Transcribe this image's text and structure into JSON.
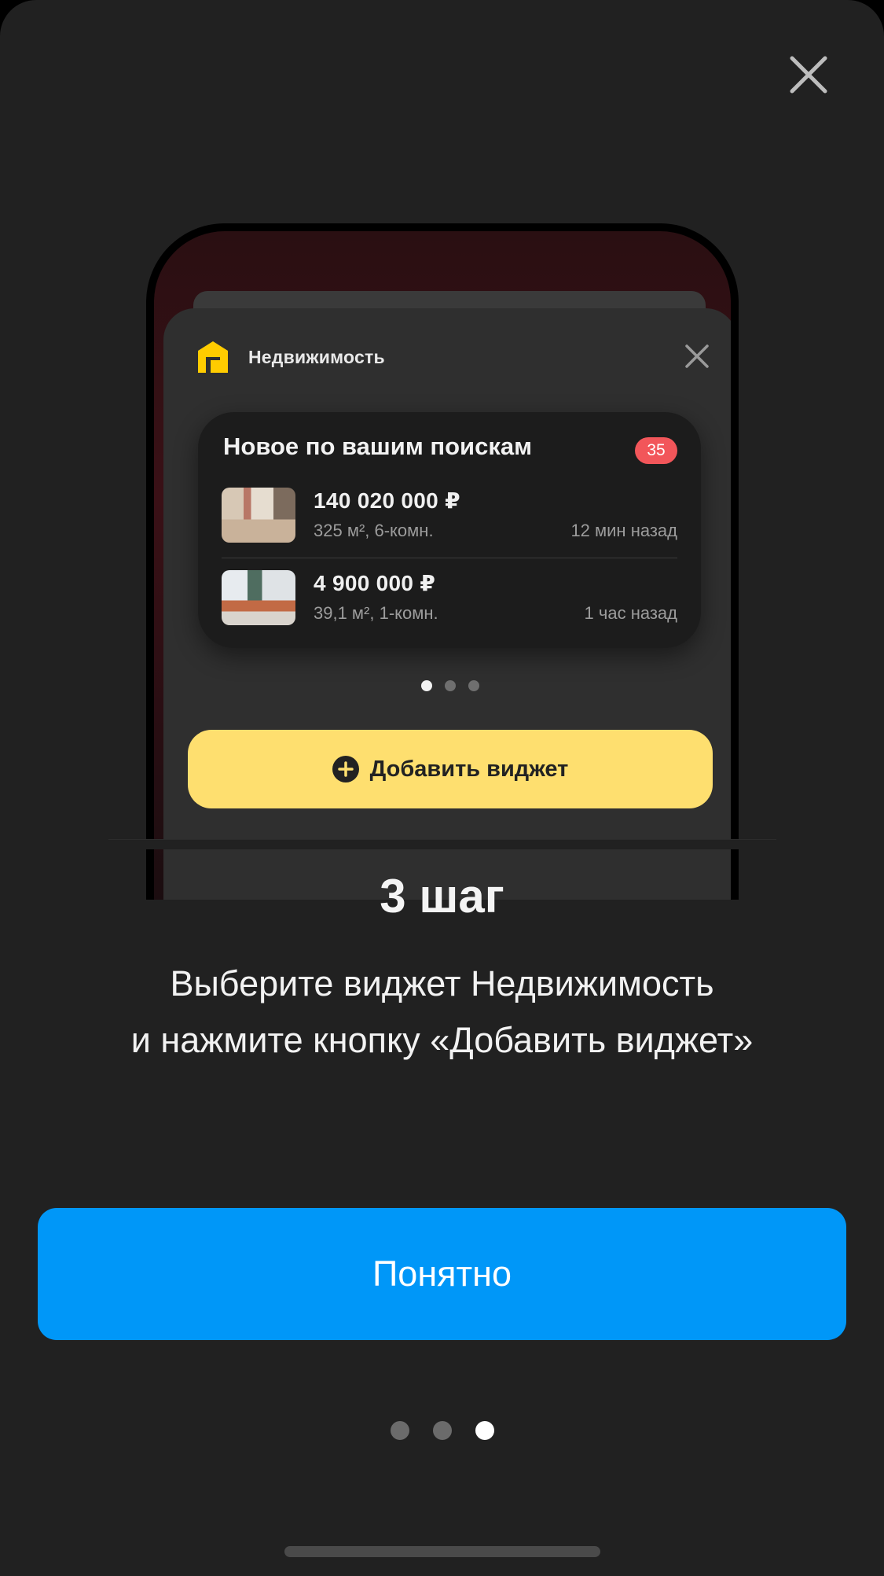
{
  "colors": {
    "sheet_bg": "#212121",
    "primary_button": "#0097f8",
    "widget_button": "#fedf6f",
    "badge": "#f2565a",
    "logo": "#ffcc00"
  },
  "preview": {
    "app_name": "Недвижимость",
    "app_icon": "house-logo-icon",
    "widget": {
      "title": "Новое по вашим поискам",
      "badge_count": "35",
      "listings": [
        {
          "price": "140 020 000 ₽",
          "details": "325 м², 6-комн.",
          "time": "12 мин назад"
        },
        {
          "price": "4 900 000 ₽",
          "details": "39,1 м², 1-комн.",
          "time": "1 час назад"
        }
      ]
    },
    "page_dots": {
      "count": 3,
      "active": 1
    },
    "add_button_label": "Добавить виджет"
  },
  "step": {
    "title": "3 шаг",
    "description_line1": "Выберите виджет Недвижимость",
    "description_line2": "и нажмите кнопку «Добавить виджет»"
  },
  "ok_button_label": "Понятно",
  "pager": {
    "count": 3,
    "active": 3
  }
}
